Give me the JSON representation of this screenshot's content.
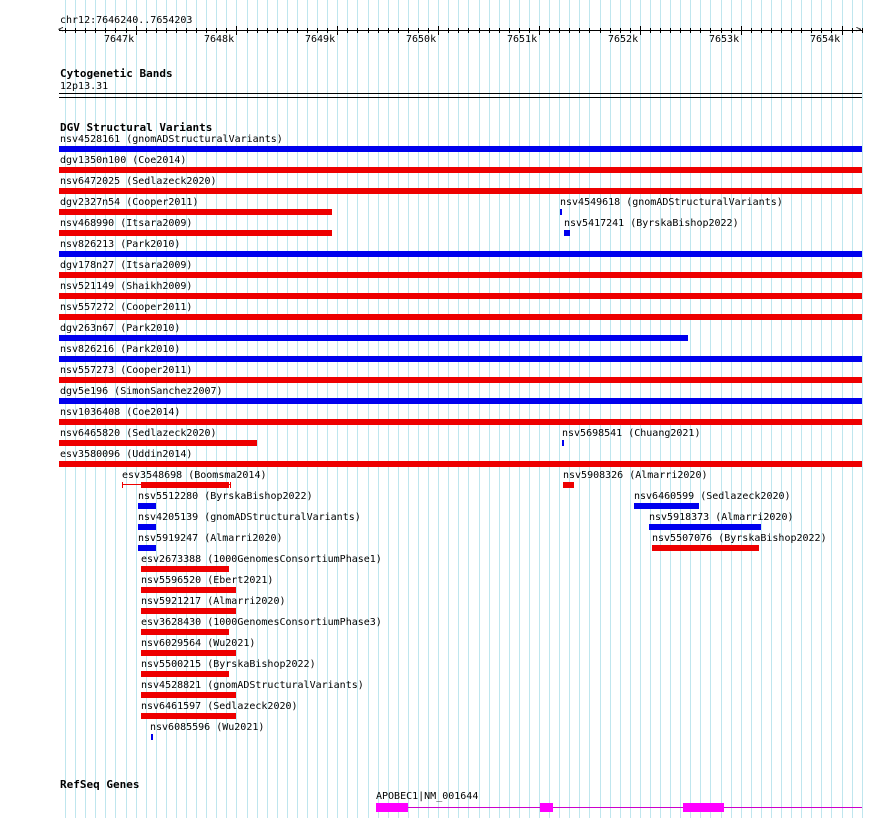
{
  "colors": {
    "gain": "#0000ee",
    "loss": "#ee0000",
    "grid": "#bfe6ee",
    "gene": "#ff00ff",
    "gene_line": "#cc00cc"
  },
  "position": "chr12:7646240..7654203",
  "ruler_ticks": [
    "7647k",
    "7648k",
    "7649k",
    "7650k",
    "7651k",
    "7652k",
    "7653k",
    "7654k"
  ],
  "cytoband": {
    "title": "Cytogenetic Bands",
    "band": "12p13.31"
  },
  "dgv": {
    "title": "DGV Structural Variants",
    "features": [
      {
        "label": "nsv4528161 (gnomADStructuralVariants)",
        "type": "gain",
        "start": 7646240,
        "end": 7654203
      },
      {
        "label": "dgv1350n100 (Coe2014)",
        "type": "loss",
        "start": 7646240,
        "end": 7654203
      },
      {
        "label": "nsv6472025 (Sedlazeck2020)",
        "type": "loss",
        "start": 7646240,
        "end": 7654203
      },
      {
        "label": "dgv2327n54 (Cooper2011)",
        "type": "loss",
        "start": 7646240,
        "end": 7648950
      },
      {
        "label": "nsv4549618 (gnomADStructuralVariants)",
        "type": "gain",
        "start": 7651212,
        "end": 7651222
      },
      {
        "label": "nsv468990 (Itsara2009)",
        "type": "loss",
        "start": 7646240,
        "end": 7648950
      },
      {
        "label": "nsv5417241 (ByrskaBishop2022)",
        "type": "gain",
        "start": 7651250,
        "end": 7651310
      },
      {
        "label": "nsv826213 (Park2010)",
        "type": "gain",
        "start": 7646240,
        "end": 7654203
      },
      {
        "label": "dgv178n27 (Itsara2009)",
        "type": "loss",
        "start": 7646240,
        "end": 7654203
      },
      {
        "label": "nsv521149 (Shaikh2009)",
        "type": "loss",
        "start": 7646240,
        "end": 7654203
      },
      {
        "label": "nsv557272 (Cooper2011)",
        "type": "loss",
        "start": 7646240,
        "end": 7654203
      },
      {
        "label": "dgv263n67 (Park2010)",
        "type": "gain",
        "start": 7646240,
        "end": 7652480
      },
      {
        "label": "nsv826216 (Park2010)",
        "type": "gain",
        "start": 7646240,
        "end": 7654203
      },
      {
        "label": "nsv557273 (Cooper2011)",
        "type": "loss",
        "start": 7646240,
        "end": 7654203
      },
      {
        "label": "dgv5e196 (SimonSanchez2007)",
        "type": "gain",
        "start": 7646240,
        "end": 7654203
      },
      {
        "label": "nsv1036408 (Coe2014)",
        "type": "loss",
        "start": 7646240,
        "end": 7654203
      },
      {
        "label": "nsv6465820 (Sedlazeck2020)",
        "type": "loss",
        "start": 7646240,
        "end": 7648200
      },
      {
        "label": "nsv5698541 (Chuang2021)",
        "type": "gain",
        "start": 7651232,
        "end": 7651245
      },
      {
        "label": "esv3580096 (Uddin2014)",
        "type": "loss",
        "start": 7646240,
        "end": 7654203
      },
      {
        "label": "esv3548698 (Boomsma2014)",
        "type": "loss_outline",
        "start": 7646860,
        "end": 7647950
      },
      {
        "label": "nsv5908326 (Almarri2020)",
        "type": "loss",
        "start": 7651240,
        "end": 7651350
      },
      {
        "label": "nsv5512280 (ByrskaBishop2022)",
        "type": "gain",
        "start": 7647020,
        "end": 7647200
      },
      {
        "label": "nsv6460599 (Sedlazeck2020)",
        "type": "gain",
        "start": 7651940,
        "end": 7652590
      },
      {
        "label": "nsv4205139 (gnomADStructuralVariants)",
        "type": "gain",
        "start": 7647020,
        "end": 7647200
      },
      {
        "label": "nsv5918373 (Almarri2020)",
        "type": "gain",
        "start": 7652090,
        "end": 7653200
      },
      {
        "label": "nsv5919247 (Almarri2020)",
        "type": "gain",
        "start": 7647020,
        "end": 7647200
      },
      {
        "label": "nsv5507076 (ByrskaBishop2022)",
        "type": "loss",
        "start": 7652120,
        "end": 7653180
      },
      {
        "label": "esv2673388 (1000GenomesConsortiumPhase1)",
        "type": "loss",
        "start": 7647050,
        "end": 7647930
      },
      {
        "label": "nsv5596520 (Ebert2021)",
        "type": "loss",
        "start": 7647050,
        "end": 7648000
      },
      {
        "label": "nsv5921217 (Almarri2020)",
        "type": "loss",
        "start": 7647050,
        "end": 7648000
      },
      {
        "label": "esv3628430 (1000GenomesConsortiumPhase3)",
        "type": "loss",
        "start": 7647050,
        "end": 7647930
      },
      {
        "label": "nsv6029564 (Wu2021)",
        "type": "loss",
        "start": 7647050,
        "end": 7648000
      },
      {
        "label": "nsv5500215 (ByrskaBishop2022)",
        "type": "loss",
        "start": 7647050,
        "end": 7647930
      },
      {
        "label": "nsv4528821 (gnomADStructuralVariants)",
        "type": "loss",
        "start": 7647050,
        "end": 7648000
      },
      {
        "label": "nsv6461597 (Sedlazeck2020)",
        "type": "loss",
        "start": 7647050,
        "end": 7648000
      },
      {
        "label": "nsv6085596 (Wu2021)",
        "type": "gain",
        "start": 7647150,
        "end": 7647170
      }
    ]
  },
  "refseq": {
    "title": "RefSeq Genes",
    "gene_label": "APOBEC1|NM_001644"
  }
}
